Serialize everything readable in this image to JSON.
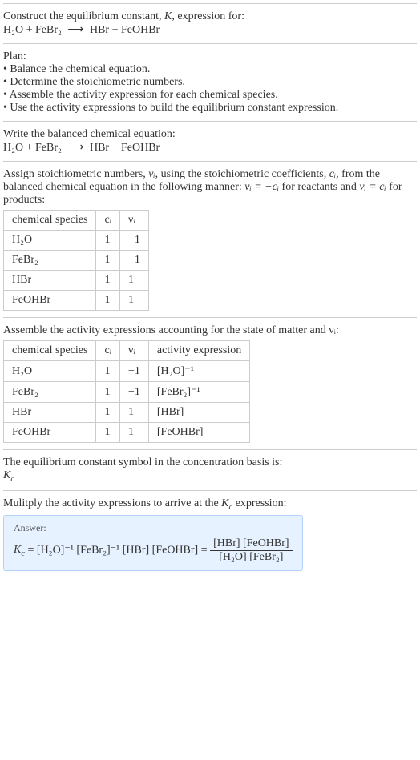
{
  "intro": {
    "line1": "Construct the equilibrium constant, ",
    "kvar": "K",
    "line1b": ", expression for:",
    "equation_lhs": "H₂O + FeBr₂",
    "arrow": "⟶",
    "equation_rhs": "HBr + FeOHBr"
  },
  "plan": {
    "heading": "Plan:",
    "b1": "• Balance the chemical equation.",
    "b2": "• Determine the stoichiometric numbers.",
    "b3": "• Assemble the activity expression for each chemical species.",
    "b4": "• Use the activity expressions to build the equilibrium constant expression."
  },
  "balanced": {
    "heading": "Write the balanced chemical equation:",
    "equation_lhs": "H₂O + FeBr₂",
    "arrow": "⟶",
    "equation_rhs": "HBr + FeOHBr"
  },
  "stoich": {
    "desc1": "Assign stoichiometric numbers, ",
    "nu": "νᵢ",
    "desc2": ", using the stoichiometric coefficients, ",
    "ci": "cᵢ",
    "desc3": ", from the balanced chemical equation in the following manner: ",
    "rel1": "νᵢ = −cᵢ",
    "desc4": " for reactants and ",
    "rel2": "νᵢ = cᵢ",
    "desc5": " for products:",
    "headers": {
      "h1": "chemical species",
      "h2": "cᵢ",
      "h3": "νᵢ"
    },
    "rows": [
      {
        "sp": "H₂O",
        "c": "1",
        "n": "−1"
      },
      {
        "sp": "FeBr₂",
        "c": "1",
        "n": "−1"
      },
      {
        "sp": "HBr",
        "c": "1",
        "n": "1"
      },
      {
        "sp": "FeOHBr",
        "c": "1",
        "n": "1"
      }
    ]
  },
  "activity": {
    "desc": "Assemble the activity expressions accounting for the state of matter and νᵢ:",
    "headers": {
      "h1": "chemical species",
      "h2": "cᵢ",
      "h3": "νᵢ",
      "h4": "activity expression"
    },
    "rows": [
      {
        "sp": "H₂O",
        "c": "1",
        "n": "−1",
        "a": "[H₂O]⁻¹"
      },
      {
        "sp": "FeBr₂",
        "c": "1",
        "n": "−1",
        "a": "[FeBr₂]⁻¹"
      },
      {
        "sp": "HBr",
        "c": "1",
        "n": "1",
        "a": "[HBr]"
      },
      {
        "sp": "FeOHBr",
        "c": "1",
        "n": "1",
        "a": "[FeOHBr]"
      }
    ]
  },
  "symbol": {
    "desc": "The equilibrium constant symbol in the concentration basis is:",
    "kc": "K_c"
  },
  "multiply": {
    "desc": "Mulitply the activity expressions to arrive at the K_c expression:"
  },
  "answer": {
    "label": "Answer:",
    "lhs": "K_c = [H₂O]⁻¹ [FeBr₂]⁻¹ [HBr] [FeOHBr] = ",
    "num": "[HBr] [FeOHBr]",
    "den": "[H₂O] [FeBr₂]"
  },
  "chart_data": {
    "type": "table",
    "tables": [
      {
        "title": "Stoichiometric numbers",
        "columns": [
          "chemical species",
          "cᵢ",
          "νᵢ"
        ],
        "rows": [
          [
            "H₂O",
            1,
            -1
          ],
          [
            "FeBr₂",
            1,
            -1
          ],
          [
            "HBr",
            1,
            1
          ],
          [
            "FeOHBr",
            1,
            1
          ]
        ]
      },
      {
        "title": "Activity expressions",
        "columns": [
          "chemical species",
          "cᵢ",
          "νᵢ",
          "activity expression"
        ],
        "rows": [
          [
            "H₂O",
            1,
            -1,
            "[H₂O]⁻¹"
          ],
          [
            "FeBr₂",
            1,
            -1,
            "[FeBr₂]⁻¹"
          ],
          [
            "HBr",
            1,
            1,
            "[HBr]"
          ],
          [
            "FeOHBr",
            1,
            1,
            "[FeOHBr]"
          ]
        ]
      }
    ]
  }
}
